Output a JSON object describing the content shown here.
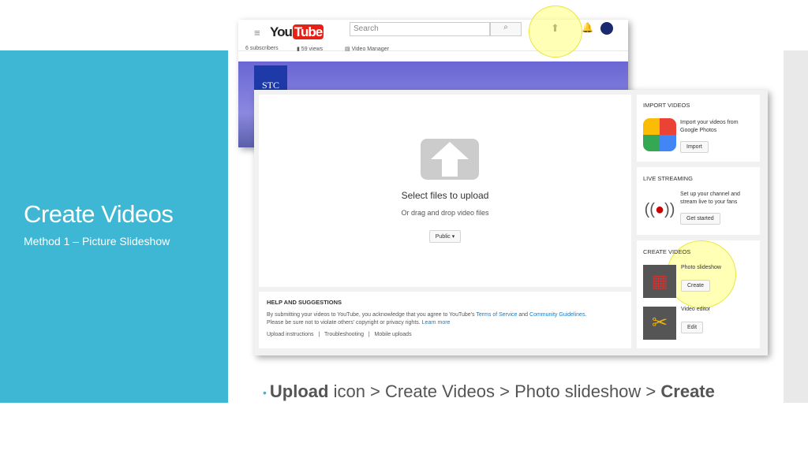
{
  "slide": {
    "title": "Create Videos",
    "subtitle": "Method 1 – Picture Slideshow"
  },
  "youtube_header": {
    "logo": "YouTube",
    "search_placeholder": "Search",
    "subscribers": "6 subscribers",
    "views": "59 views",
    "video_manager": "Video Manager",
    "channel_badge": "STC"
  },
  "upload": {
    "heading": "Select files to upload",
    "subheading": "Or drag and drop video files",
    "privacy": "Public ▾"
  },
  "help": {
    "heading": "HELP AND SUGGESTIONS",
    "line1_pre": "By submitting your videos to YouTube, you acknowledge that you agree to YouTube's ",
    "tos": "Terms of Service",
    "and": " and ",
    "guidelines": "Community Guidelines",
    "line1_post": ".",
    "line2_pre": "Please be sure not to violate others' copyright or privacy rights. ",
    "learn_more": "Learn more",
    "links": [
      "Upload instructions",
      "Troubleshooting",
      "Mobile uploads"
    ]
  },
  "import": {
    "heading": "IMPORT VIDEOS",
    "text": "Import your videos from Google Photos",
    "button": "Import"
  },
  "live": {
    "heading": "LIVE STREAMING",
    "text": "Set up your channel and stream live to your fans",
    "button": "Get started"
  },
  "create": {
    "heading": "CREATE VIDEOS",
    "slideshow": "Photo slideshow",
    "slideshow_button": "Create",
    "editor": "Video editor",
    "editor_button": "Edit"
  },
  "caption": {
    "b1": "Upload",
    "t1": " icon > Create Videos > Photo slideshow > ",
    "b2": "Create"
  },
  "colors": {
    "accent": "#3db7d4",
    "youtube_red": "#e62117",
    "highlight": "#ffff78"
  }
}
